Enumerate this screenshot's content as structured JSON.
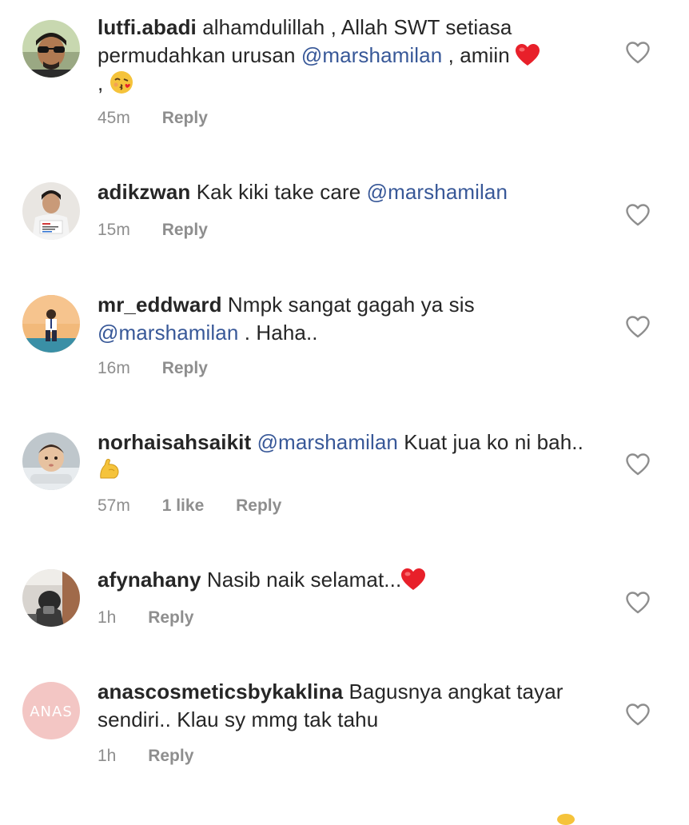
{
  "comments": [
    {
      "username": "lutfi.abadi",
      "text_1": " alhamdulillah , Allah SWT setiasa permudahkan urusan ",
      "mention": "@marshamilan",
      "text_2": " , amiin ",
      "text_3": " , ",
      "time": "45m",
      "likes": "",
      "reply": "Reply"
    },
    {
      "username": "adikzwan",
      "text_1": " Kak kiki take care ",
      "mention": "@marshamilan",
      "text_2": "",
      "time": "15m",
      "likes": "",
      "reply": "Reply"
    },
    {
      "username": "mr_eddward",
      "text_1": " Nmpk sangat gagah ya sis ",
      "mention": "@marshamilan",
      "text_2": " . Haha..",
      "time": "16m",
      "likes": "",
      "reply": "Reply"
    },
    {
      "username": "norhaisahsaikit",
      "text_1": " ",
      "mention": "@marshamilan",
      "text_2": " Kuat jua ko ni bah.. ",
      "time": "57m",
      "likes": "1 like",
      "reply": "Reply"
    },
    {
      "username": "afynahany",
      "text_1": " Nasib naik selamat...",
      "mention": "",
      "text_2": "",
      "time": "1h",
      "likes": "",
      "reply": "Reply"
    },
    {
      "username": "anascosmeticsbykaklina",
      "text_1": " Bagusnya angkat tayar sendiri.. Klau sy mmg tak tahu",
      "mention": "",
      "text_2": "",
      "time": "1h",
      "likes": "",
      "reply": "Reply",
      "avatar_text": "ANAS"
    }
  ],
  "icons": {
    "like": "heart-outline-icon",
    "red_heart": "red-heart-emoji",
    "kiss": "face-blowing-kiss-emoji",
    "muscle": "flexed-biceps-emoji"
  },
  "colors": {
    "text": "#262626",
    "mention": "#385898",
    "meta": "#8e8e8e",
    "heart_red": "#e8202a"
  }
}
